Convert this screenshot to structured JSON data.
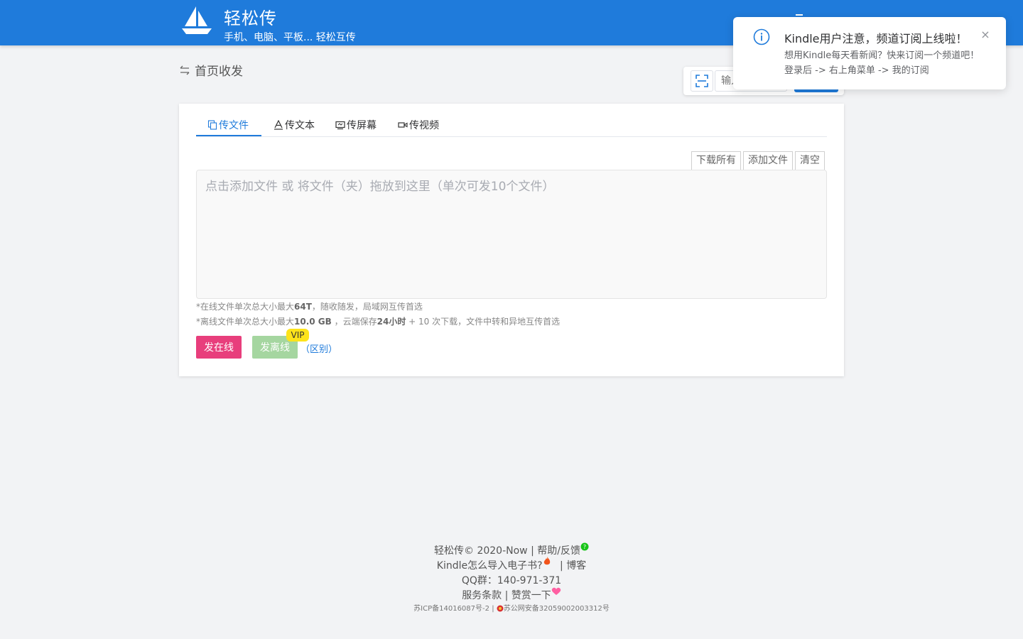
{
  "header": {
    "title": "轻松传",
    "subtitle": "手机、电脑、平板... 轻松互传"
  },
  "breadcrumb": {
    "label": "首页收发"
  },
  "scan": {
    "input_placeholder": "输入"
  },
  "notification": {
    "title": "Kindle用户注意，频道订阅上线啦！",
    "body": "想用Kindle每天看新闻？快来订阅一个频道吧！登录后 -> 右上角菜单 -> 我的订阅",
    "close": "×"
  },
  "tabs": [
    {
      "label": "传文件",
      "icon": "file-copy-icon"
    },
    {
      "label": "传文本",
      "icon": "text-icon"
    },
    {
      "label": "传屏幕",
      "icon": "screen-icon"
    },
    {
      "label": "传视频",
      "icon": "video-icon"
    }
  ],
  "actions": {
    "download_all": "下载所有",
    "add_file": "添加文件",
    "clear": "清空"
  },
  "dropzone": {
    "placeholder": "点击添加文件 或 将文件（夹）拖放到这里（单次可发10个文件）"
  },
  "notes": {
    "online_prefix": "*在线文件单次总大小最大",
    "online_size": "64T",
    "online_suffix": "，随收随发，局域网互传首选",
    "offline_prefix": "*离线文件单次总大小最大",
    "offline_size": "10.0 GB",
    "offline_mid": " ，云端保存",
    "offline_hours": "24小时",
    "offline_suffix": " + 10 次下载，文件中转和异地互传首选"
  },
  "buttons": {
    "send_online": "发在线",
    "send_offline": "发离线",
    "vip": "VIP",
    "difference": "（区别）"
  },
  "footer": {
    "copyright": "轻松传© 2020-Now",
    "sep": "|",
    "help": "帮助/反馈",
    "kindle": "Kindle怎么导入电子书?",
    "blog": "博客",
    "qq": "QQ群：140-971-371",
    "terms": "服务条款",
    "donate": "赞赏一下",
    "icp": "苏ICP备14016087号-2",
    "police": "苏公网安备32059002003312号"
  },
  "colors": {
    "primary": "#1f7bdb",
    "online": "#e83e7c",
    "offline": "#a5d6a0",
    "vip": "#fde31a"
  }
}
